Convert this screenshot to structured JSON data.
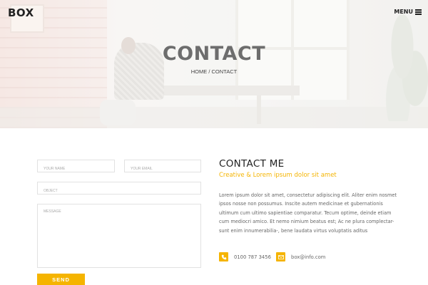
{
  "header": {
    "logo": "BOX",
    "menu_label": "MENU",
    "menu_icon": "hamburger-icon"
  },
  "hero": {
    "title": "CONTACT",
    "breadcrumb": "HOME / CONTACT"
  },
  "form": {
    "name_placeholder": "YOUR NAME",
    "email_placeholder": "YOUR EMAIL",
    "object_placeholder": "OBJECT",
    "message_placeholder": "MESSAGE",
    "send_label": "SEND"
  },
  "info": {
    "title": "CONTACT ME",
    "subtitle": "Creative & Lorem ipsum dolor sit amet",
    "body": "Lorem ipsum dolor sit amet, consectetur adipiscing elit. Aliter enim nosmet ipsos nosse non possumus. Inscite autem medicinae et gubernationis ultimum cum ultimo sapientiae comparatur. Tecum optime, deinde etiam cum mediocri amico. Et nemo nimium beatus est; Ac ne plura complectar-sunt enim innumerabilia-, bene laudata virtus voluptatis aditus",
    "phone": "0100 787 3456",
    "phone_icon": "phone-icon",
    "email": "box@info.com",
    "email_icon": "envelope-icon"
  },
  "colors": {
    "accent": "#f5b400",
    "text_dark": "#222222",
    "text_muted": "#666666"
  }
}
